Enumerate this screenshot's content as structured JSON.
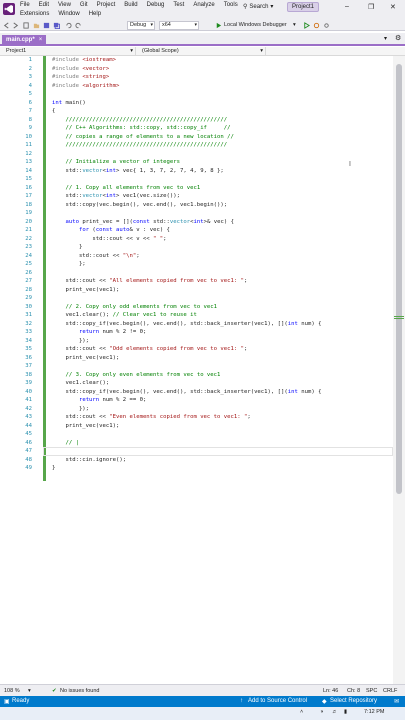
{
  "menu": {
    "row1": [
      "File",
      "Edit",
      "View",
      "Git",
      "Project",
      "Build",
      "Debug",
      "Test",
      "Analyze",
      "Tools"
    ],
    "row2": [
      "Extensions",
      "Window",
      "Help"
    ],
    "search_label": "Search",
    "project_name": "Project1"
  },
  "toolbar": {
    "config": "Debug",
    "platform": "x64",
    "run_label": "Local Windows Debugger"
  },
  "tab": {
    "label": "main.cpp*",
    "close": "×"
  },
  "navbar": {
    "scope1": "Project1",
    "scope2": "(Global Scope)"
  },
  "editor": {
    "line_numbers": [
      "1",
      "2",
      "3",
      "4",
      "5",
      "6",
      "7",
      "8",
      "9",
      "10",
      "11",
      "12",
      "13",
      "14",
      "15",
      "16",
      "17",
      "18",
      "19",
      "20",
      "21",
      "22",
      "23",
      "24",
      "25",
      "26",
      "27",
      "28",
      "29",
      "30",
      "31",
      "32",
      "33",
      "34",
      "35",
      "36",
      "37",
      "38",
      "39",
      "40",
      "41",
      "42",
      "43",
      "44",
      "45",
      "46",
      "47",
      "48",
      "49"
    ],
    "lines": [
      "#include <iostream>",
      "#include <vector>",
      "#include <string>",
      "#include <algorithm>",
      "",
      "int main()",
      "{",
      "    ////////////////////////////////////////////////",
      "    // C++ Algorithms: std::copy, std::copy_if     //",
      "    // copies a range of elements to a new location //",
      "    ////////////////////////////////////////////////",
      "",
      "    // Initialize a vector of integers",
      "    std::vector<int> vec{ 1, 3, 7, 2, 7, 4, 9, 8 };",
      "",
      "    // 1. Copy all elements from vec to vec1",
      "    std::vector<int> vec1(vec.size());",
      "    std::copy(vec.begin(), vec.end(), vec1.begin());",
      "",
      "    auto print_vec = [](const std::vector<int>& vec) {",
      "        for (const auto& v : vec) {",
      "            std::cout << v << \" \";",
      "        }",
      "        std::cout << \"\\n\";",
      "        };",
      "",
      "    std::cout << \"All elements copied from vec to vec1: \";",
      "    print_vec(vec1);",
      "",
      "    // 2. Copy only odd elements from vec to vec1",
      "    vec1.clear(); // Clear vec1 to reuse it",
      "    std::copy_if(vec.begin(), vec.end(), std::back_inserter(vec1), [](int num) {",
      "        return num % 2 != 0;",
      "        });",
      "    std::cout << \"Odd elements copied from vec to vec1: \";",
      "    print_vec(vec1);",
      "",
      "    // 3. Copy only even elements from vec to vec1",
      "    vec1.clear();",
      "    std::copy_if(vec.begin(), vec.end(), std::back_inserter(vec1), [](int num) {",
      "        return num % 2 == 0;",
      "        });",
      "    std::cout << \"Even elements copied from vec to vec1: \";",
      "    print_vec(vec1);",
      "",
      "    // |",
      "",
      "    std::cin.ignore();",
      "}"
    ]
  },
  "infobar": {
    "zoom": "108 %",
    "issues": "No issues found",
    "line": "Ln: 46",
    "col": "Ch: 8",
    "spc": "SPC",
    "eol": "CRLF"
  },
  "statusbar": {
    "ready": "Ready",
    "source_control": "Add to Source Control",
    "repository": "Select Repository"
  },
  "taskbar": {
    "time": "7:12 PM"
  },
  "colors": {
    "accent": "#9b6ec7",
    "status": "#007acc",
    "change": "#57a64a"
  }
}
